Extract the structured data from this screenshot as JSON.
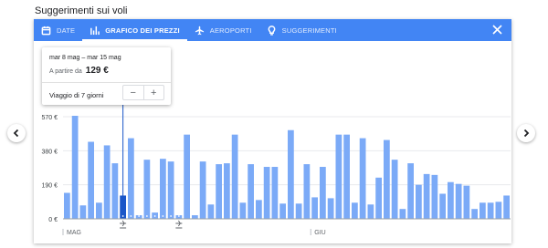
{
  "page": {
    "heading": "Suggerimenti sui voli"
  },
  "tabs": [
    {
      "label": "DATE",
      "icon": "calendar-icon",
      "active": false
    },
    {
      "label": "GRAFICO DEI PREZZI",
      "icon": "bar-chart-icon",
      "active": true
    },
    {
      "label": "AEROPORTI",
      "icon": "airplane-icon",
      "active": false
    },
    {
      "label": "SUGGERIMENTI",
      "icon": "lightbulb-icon",
      "active": false
    }
  ],
  "colors": {
    "accent": "#4285f4",
    "bar": "#7baaf7",
    "bar_selected": "#1a56c8"
  },
  "popup": {
    "dates": "mar 8 mag – mar 15 mag",
    "price_prefix": "A partire da",
    "price": "129 €",
    "trip_length": "Viaggio di 7 giorni",
    "minus": "−",
    "plus": "+"
  },
  "chart_data": {
    "type": "bar",
    "ylim": [
      0,
      570
    ],
    "ytick_labels": [
      "570 €",
      "380 €",
      "190 €",
      "0 €"
    ],
    "ytick_values": [
      570,
      380,
      190,
      0
    ],
    "month_labels": [
      {
        "label": "MAG",
        "index": 0
      },
      {
        "label": "GIU",
        "index": 31
      }
    ],
    "selected_index": 7,
    "selected_value": 129,
    "values": [
      145,
      575,
      75,
      430,
      90,
      410,
      310,
      130,
      450,
      20,
      330,
      35,
      335,
      320,
      20,
      470,
      20,
      320,
      80,
      305,
      310,
      470,
      90,
      305,
      105,
      290,
      290,
      85,
      495,
      85,
      305,
      120,
      290,
      115,
      470,
      470,
      90,
      450,
      80,
      230,
      440,
      330,
      55,
      310,
      190,
      250,
      245,
      140,
      205,
      195,
      185,
      55,
      90,
      90,
      95,
      130
    ]
  }
}
